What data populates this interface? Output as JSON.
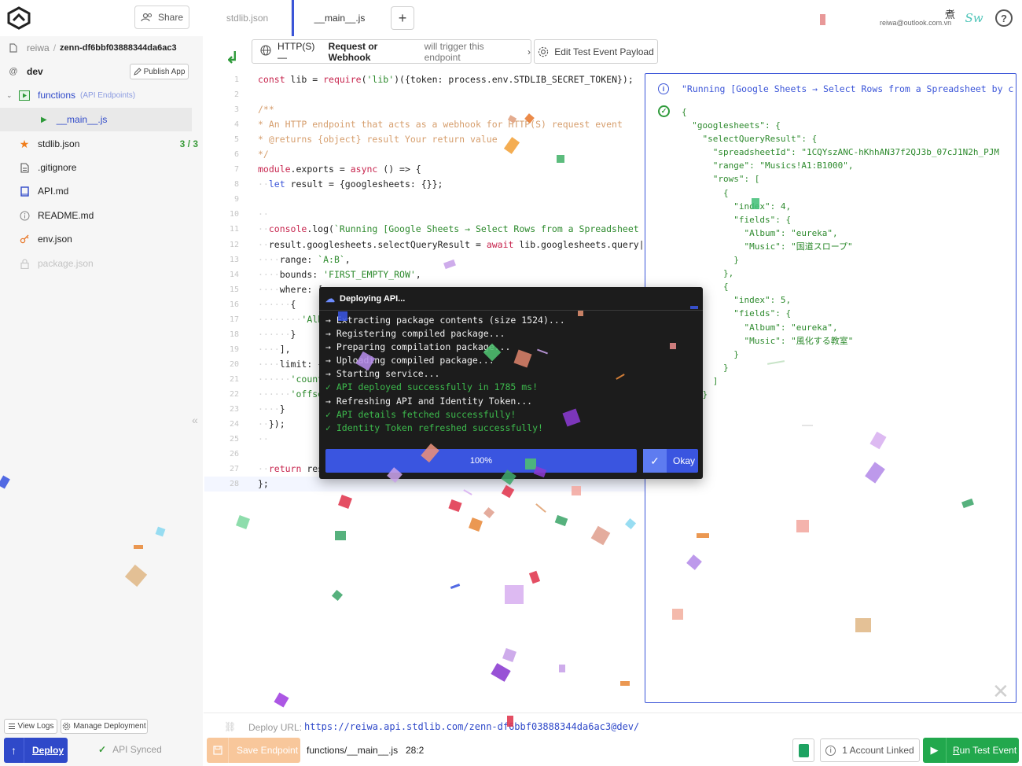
{
  "topbar": {
    "share_label": "Share",
    "tabs": [
      {
        "label": "stdlib.json",
        "active": false
      },
      {
        "label": "__main__.js",
        "active": true
      }
    ],
    "add_tab": "+",
    "user": {
      "email": "reiwa@outlook.com.vn",
      "kanji": "煮",
      "signature": "Sw"
    },
    "help": "?"
  },
  "sidebar": {
    "breadcrumb": {
      "user": "reiwa",
      "separator": "/",
      "project": "zenn-df6bbf03888344da6ac3"
    },
    "environment": "dev",
    "publish_label": "Publish App",
    "functions": {
      "label": "functions",
      "sub": "(API Endpoints)"
    },
    "main_file": "__main__.js",
    "files": [
      {
        "name": "stdlib.json",
        "icon": "star-icon",
        "badge": "3 / 3",
        "enabled": true
      },
      {
        "name": ".gitignore",
        "icon": "file-icon",
        "badge": "",
        "enabled": true
      },
      {
        "name": "API.md",
        "icon": "book-icon",
        "badge": "",
        "enabled": true
      },
      {
        "name": "README.md",
        "icon": "info-icon",
        "badge": "",
        "enabled": true
      },
      {
        "name": "env.json",
        "icon": "key-icon",
        "badge": "",
        "enabled": true
      },
      {
        "name": "package.json",
        "icon": "lock-icon",
        "badge": "",
        "enabled": false
      }
    ],
    "view_logs": "View Logs",
    "manage_deployment": "Manage Deployment",
    "deploy": "Deploy",
    "sync_status": "API Synced"
  },
  "toolbar": {
    "trigger_part1": "HTTP(S) —",
    "trigger_part2": "Request or Webhook",
    "trigger_part3": "will trigger this endpoint",
    "edit_payload": "Edit Test Event Payload"
  },
  "code_lines": [
    [
      {
        "c": "k",
        "t": "const "
      },
      {
        "c": "f",
        "t": "lib = "
      },
      {
        "c": "k",
        "t": "require"
      },
      {
        "c": "f",
        "t": "("
      },
      {
        "c": "s",
        "t": "'lib'"
      },
      {
        "c": "f",
        "t": ")({token: process.env.STDLIB_SECRET_TOKEN});"
      }
    ],
    [],
    [
      {
        "c": "c",
        "t": "/**"
      }
    ],
    [
      {
        "c": "c",
        "t": "* An HTTP endpoint that acts as a webhook for HTTP(S) request event"
      }
    ],
    [
      {
        "c": "c",
        "t": "* @returns {object} result Your return value"
      }
    ],
    [
      {
        "c": "c",
        "t": "*/"
      }
    ],
    [
      {
        "c": "k",
        "t": "module"
      },
      {
        "c": "f",
        "t": ".exports = "
      },
      {
        "c": "k",
        "t": "async"
      },
      {
        "c": "f",
        "t": " () => {"
      }
    ],
    [
      {
        "c": "d",
        "t": "··"
      },
      {
        "c": "b",
        "t": "let"
      },
      {
        "c": "f",
        "t": " result = {googlesheets: {}};"
      }
    ],
    [],
    [
      {
        "c": "d",
        "t": "··"
      }
    ],
    [
      {
        "c": "d",
        "t": "··"
      },
      {
        "c": "k",
        "t": "console"
      },
      {
        "c": "f",
        "t": ".log("
      },
      {
        "c": "s",
        "t": "`Running [Google Sheets → Select Rows from a Spreadsheet"
      }
    ],
    [
      {
        "c": "d",
        "t": "··"
      },
      {
        "c": "f",
        "t": "result.googlesheets.selectQueryResult = "
      },
      {
        "c": "k",
        "t": "await"
      },
      {
        "c": "f",
        "t": " lib.googlesheets.query|"
      }
    ],
    [
      {
        "c": "d",
        "t": "····"
      },
      {
        "c": "f",
        "t": "range: "
      },
      {
        "c": "s",
        "t": "`A:B`"
      },
      {
        "c": "f",
        "t": ","
      }
    ],
    [
      {
        "c": "d",
        "t": "····"
      },
      {
        "c": "f",
        "t": "bounds: "
      },
      {
        "c": "s",
        "t": "'FIRST_EMPTY_ROW'"
      },
      {
        "c": "f",
        "t": ","
      }
    ],
    [
      {
        "c": "d",
        "t": "····"
      },
      {
        "c": "f",
        "t": "where: ["
      }
    ],
    [
      {
        "c": "d",
        "t": "······"
      },
      {
        "c": "f",
        "t": "{"
      }
    ],
    [
      {
        "c": "d",
        "t": "········"
      },
      {
        "c": "s",
        "t": "'Album'"
      }
    ],
    [
      {
        "c": "d",
        "t": "······"
      },
      {
        "c": "f",
        "t": "}"
      }
    ],
    [
      {
        "c": "d",
        "t": "····"
      },
      {
        "c": "f",
        "t": "],"
      }
    ],
    [
      {
        "c": "d",
        "t": "····"
      },
      {
        "c": "f",
        "t": "limit: {"
      }
    ],
    [
      {
        "c": "d",
        "t": "······"
      },
      {
        "c": "s",
        "t": "'count'"
      }
    ],
    [
      {
        "c": "d",
        "t": "······"
      },
      {
        "c": "s",
        "t": "'offset'"
      }
    ],
    [
      {
        "c": "d",
        "t": "····"
      },
      {
        "c": "f",
        "t": "}"
      }
    ],
    [
      {
        "c": "d",
        "t": "··"
      },
      {
        "c": "f",
        "t": "});"
      }
    ],
    [
      {
        "c": "d",
        "t": "··"
      }
    ],
    [],
    [
      {
        "c": "d",
        "t": "··"
      },
      {
        "c": "k",
        "t": "return"
      },
      {
        "c": "f",
        "t": " result;"
      }
    ],
    [
      {
        "c": "f",
        "t": "};"
      }
    ]
  ],
  "active_line": 28,
  "result_panel": {
    "title": "\"Running [Google Sheets → Select Rows from a Spreadsheet by c",
    "body": "{\n  \"googlesheets\": {\n    \"selectQueryResult\": {\n      \"spreadsheetId\": \"1CQYszANC-hKhhAN37f2QJ3b_07cJ1N2h_PJM\n      \"range\": \"Musics!A1:B1000\",\n      \"rows\": [\n        {\n          \"index\": 4,\n          \"fields\": {\n            \"Album\": \"eureka\",\n            \"Music\": \"国道スロープ\"\n          }\n        },\n        {\n          \"index\": 5,\n          \"fields\": {\n            \"Album\": \"eureka\",\n            \"Music\": \"風化する教室\"\n          }\n        }\n      ]\n    }"
  },
  "modal": {
    "title": "Deploying API...",
    "log": [
      {
        "status": "w",
        "text": "→ Extracting package contents (size 1524)..."
      },
      {
        "status": "w",
        "text": "→ Registering compiled package..."
      },
      {
        "status": "w",
        "text": "→ Preparing compilation package..."
      },
      {
        "status": "w",
        "text": "→ Uploading compiled package..."
      },
      {
        "status": "w",
        "text": "→ Starting service..."
      },
      {
        "status": "g",
        "text": "✓ API deployed successfully in 1785 ms!"
      },
      {
        "status": "w",
        "text": "→ Refreshing API and Identity Token..."
      },
      {
        "status": "g",
        "text": "✓ API details fetched successfully!"
      },
      {
        "status": "g",
        "text": "✓ Identity Token refreshed successfully!"
      }
    ],
    "progress_label": "100%",
    "progress": 1.0,
    "okay": "Okay"
  },
  "bottom": {
    "deploy_url_label": "Deploy URL:",
    "deploy_url": "https://reiwa.api.stdlib.com/zenn-df6bbf03888344da6ac3@dev/",
    "save": "Save Endpoint",
    "file_path": "functions/__main__.js",
    "cursor": "28:2",
    "accounts": "1 Account Linked",
    "run_part1": "R",
    "run_part2": "un Test Event"
  },
  "colors": {
    "accent": "#3b55d8",
    "success": "#22a84d",
    "save": "#f8c79b"
  }
}
